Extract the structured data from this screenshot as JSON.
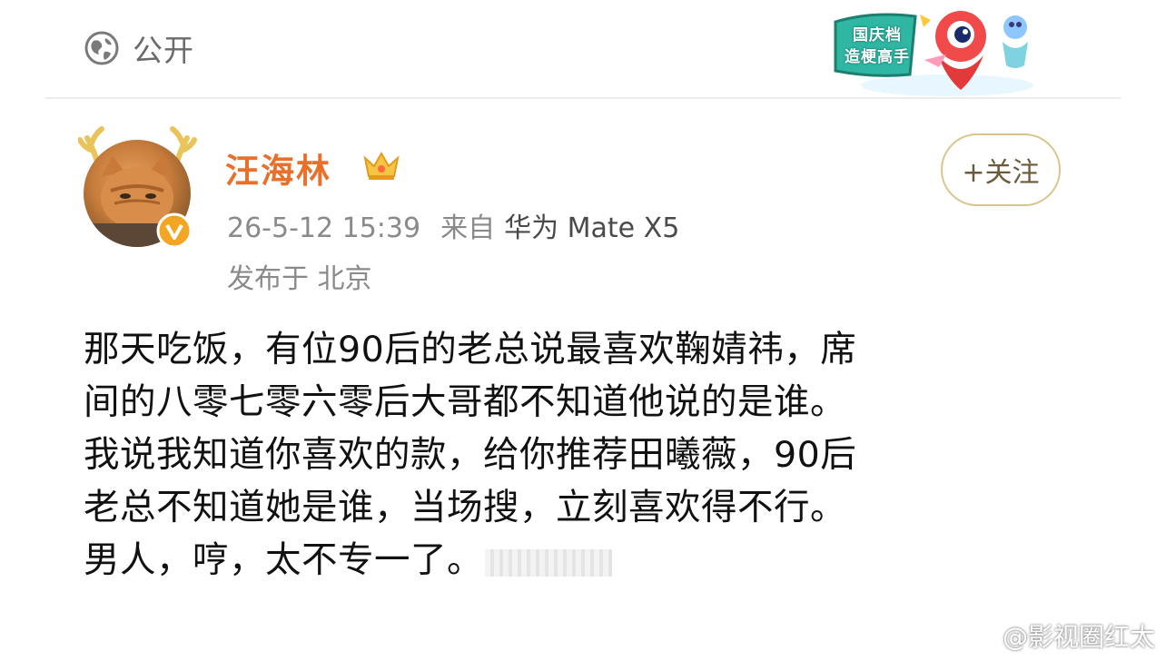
{
  "header": {
    "visibility_icon": "globe-icon",
    "visibility_label": "公开",
    "sticker": {
      "line1": "国庆档",
      "line2": "造梗高手"
    }
  },
  "post": {
    "author": {
      "name": "汪海林",
      "name_color": "#e8702b",
      "badge": "crown-icon",
      "verified_icon": "verified-v-icon"
    },
    "timestamp": "26-5-12 15:39",
    "source_prefix": "来自",
    "device": "华为 Mate X5",
    "location": "发布于 北京",
    "follow_label": "+关注",
    "body_lines": [
      "那天吃饭，有位90后的老总说最喜欢鞠婧祎，席",
      "间的八零七零六零后大哥都不知道他说的是谁。",
      "我说我知道你喜欢的款，给你推荐田曦薇，90后",
      "老总不知道她是谁，当场搜，立刻喜欢得不行。",
      "男人，哼，太不专一了。"
    ]
  },
  "watermark": {
    "icon": "weibo-icon",
    "text": "@影视圈红太"
  }
}
